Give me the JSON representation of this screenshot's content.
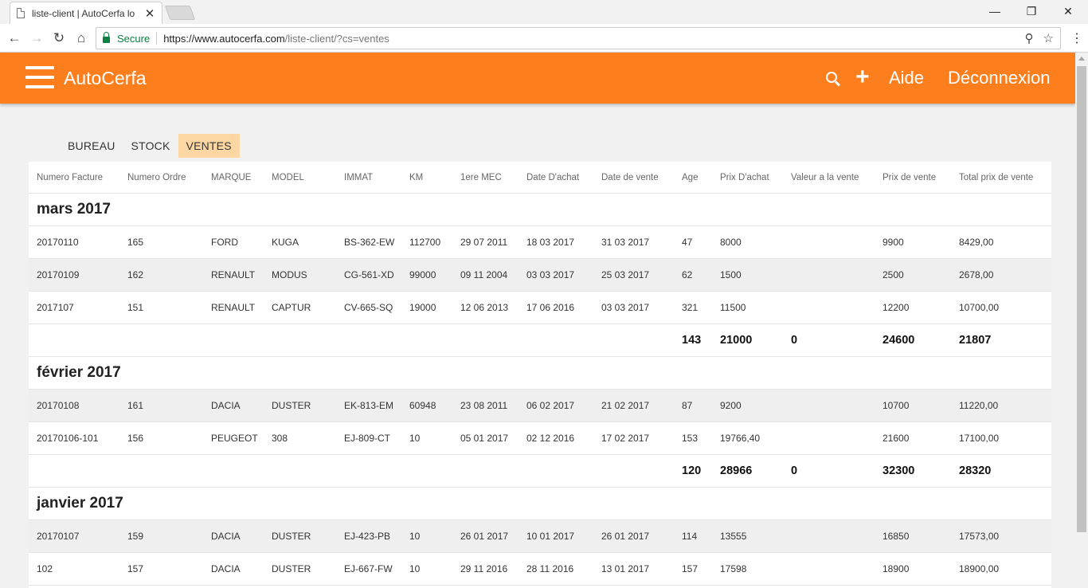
{
  "browser": {
    "tab_title": "liste-client | AutoCerfa lo",
    "tab_close": "✕",
    "win_minimize": "—",
    "win_restore": "❐",
    "win_close": "✕",
    "secure_label": "Secure",
    "url_host": "https://www.autocerfa.com",
    "url_rest": "/liste-client/?cs=ventes"
  },
  "app": {
    "brand": "AutoCerfa",
    "plus_label": "+",
    "help_label": "Aide",
    "logout_label": "Déconnexion",
    "accent_color": "#fd7e1c"
  },
  "nav": {
    "tabs": [
      "BUREAU",
      "STOCK",
      "VENTES"
    ],
    "active": "VENTES"
  },
  "columns": [
    "Numero Facture",
    "Numero Ordre",
    "MARQUE",
    "MODEL",
    "IMMAT",
    "KM",
    "1ere MEC",
    "Date D'achat",
    "Date de vente",
    "Age",
    "Prix D'achat",
    "Valeur a la vente",
    "Prix de vente",
    "Total prix de vente"
  ],
  "groups": [
    {
      "month": "mars 2017",
      "rows": [
        [
          "20170110",
          "165",
          "FORD",
          "KUGA",
          "BS-362-EW",
          "112700",
          "29 07 2011",
          "18 03 2017",
          "31 03 2017",
          "47",
          "8000",
          "",
          "9900",
          "8429,00"
        ],
        [
          "20170109",
          "162",
          "RENAULT",
          "MODUS",
          "CG-561-XD",
          "99000",
          "09 11 2004",
          "03 03 2017",
          "25 03 2017",
          "62",
          "1500",
          "",
          "2500",
          "2678,00"
        ],
        [
          "2017107",
          "151",
          "RENAULT",
          "CAPTUR",
          "CV-665-SQ",
          "19000",
          "12 06 2013",
          "17 06 2016",
          "03 03 2017",
          "321",
          "11500",
          "",
          "12200",
          "10700,00"
        ]
      ],
      "totals": {
        "age": "143",
        "prix_achat": "21000",
        "valeur": "0",
        "prix_vente": "24600",
        "total": "21807"
      }
    },
    {
      "month": "février 2017",
      "rows": [
        [
          "20170108",
          "161",
          "DACIA",
          "DUSTER",
          "EK-813-EM",
          "60948",
          "23 08 2011",
          "06 02 2017",
          "21 02 2017",
          "87",
          "9200",
          "",
          "10700",
          "11220,00"
        ],
        [
          "20170106-101",
          "156",
          "PEUGEOT",
          "308",
          "EJ-809-CT",
          "10",
          "05 01 2017",
          "02 12 2016",
          "17 02 2017",
          "153",
          "19766,40",
          "",
          "21600",
          "17100,00"
        ]
      ],
      "totals": {
        "age": "120",
        "prix_achat": "28966",
        "valeur": "0",
        "prix_vente": "32300",
        "total": "28320"
      }
    },
    {
      "month": "janvier 2017",
      "rows": [
        [
          "20170107",
          "159",
          "DACIA",
          "DUSTER",
          "EJ-423-PB",
          "10",
          "26 01 2017",
          "10 01 2017",
          "26 01 2017",
          "114",
          "13555",
          "",
          "16850",
          "17573,00"
        ],
        [
          "102",
          "157",
          "DACIA",
          "DUSTER",
          "EJ-667-FW",
          "10",
          "29 11 2016",
          "28 11 2016",
          "13 01 2017",
          "157",
          "17598",
          "",
          "18900",
          "18900,00"
        ]
      ]
    }
  ]
}
